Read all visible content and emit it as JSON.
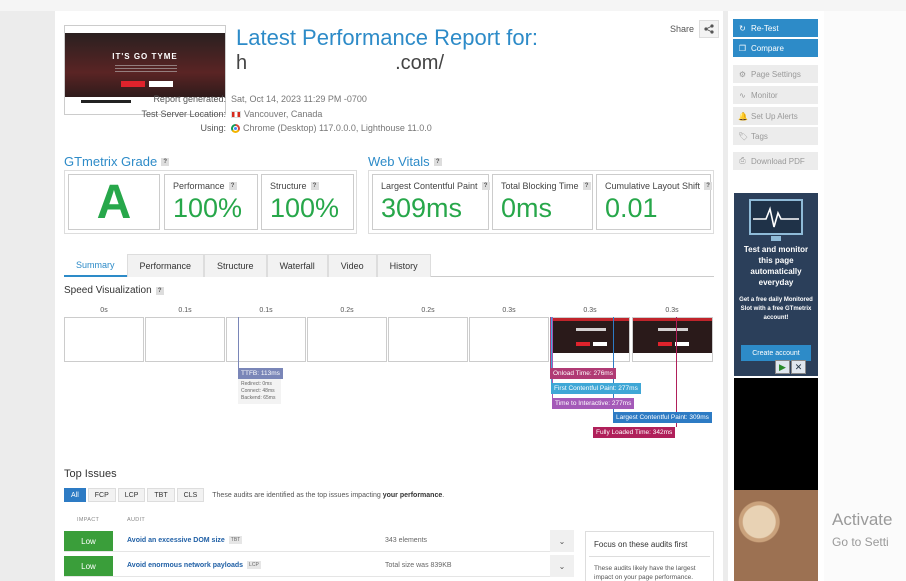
{
  "header": {
    "title": "Latest Performance Report for:",
    "url_visible_prefix": "h",
    "url_visible_suffix": ".com/",
    "share_label": "Share",
    "thumbnail_headline": "IT'S GO TYME"
  },
  "meta": {
    "report_generated_label": "Report generated:",
    "report_generated_value": "Sat, Oct 14, 2023 11:29 PM -0700",
    "location_label": "Test Server Location:",
    "location_value": "Vancouver, Canada",
    "using_label": "Using:",
    "using_value": "Chrome (Desktop) 117.0.0.0, Lighthouse 11.0.0"
  },
  "grade": {
    "section_title": "GTmetrix Grade",
    "letter": "A",
    "performance_label": "Performance",
    "performance_value": "100%",
    "structure_label": "Structure",
    "structure_value": "100%"
  },
  "vitals": {
    "section_title": "Web Vitals",
    "lcp_label": "Largest Contentful Paint",
    "lcp_value": "309ms",
    "tbt_label": "Total Blocking Time",
    "tbt_value": "0ms",
    "cls_label": "Cumulative Layout Shift",
    "cls_value": "0.01"
  },
  "tabs": [
    "Summary",
    "Performance",
    "Structure",
    "Waterfall",
    "Video",
    "History"
  ],
  "speed_viz": {
    "title": "Speed Visualization",
    "frame_labels": [
      "0s",
      "0.1s",
      "0.1s",
      "0.2s",
      "0.2s",
      "0.3s",
      "0.3s",
      "0.3s"
    ],
    "ttfb_tag": "TTFB: 113ms",
    "ttfb_redirect": "Redirect: 0ms",
    "ttfb_connect": "Connect: 48ms",
    "ttfb_backend": "Backend: 65ms",
    "onload_tag": "Onload Time: 276ms",
    "fcp_tag": "First Contentful Paint: 277ms",
    "tti_tag": "Time to Interactive: 277ms",
    "lcp_tag": "Largest Contentful Paint: 309ms",
    "fully_loaded_tag": "Fully Loaded Time: 342ms",
    "colors": {
      "ttfb": "#7a86b8",
      "onload": "#b03a74",
      "fcp": "#3fa7d6",
      "tti": "#a45ab8",
      "lcp": "#2d7bc4",
      "fully": "#b0205a"
    }
  },
  "top_issues": {
    "title": "Top Issues",
    "filters": [
      "All",
      "FCP",
      "LCP",
      "TBT",
      "CLS"
    ],
    "note_prefix": "These audits are identified as the top issues impacting",
    "note_bold": "your performance",
    "note_suffix": ".",
    "col_impact": "IMPACT",
    "col_audit": "AUDIT",
    "audits": [
      {
        "impact": "Low",
        "name": "Avoid an excessive DOM size",
        "metric": "TBT",
        "detail": "343 elements"
      },
      {
        "impact": "Low",
        "name": "Avoid enormous network payloads",
        "metric": "LCP",
        "detail": "Total size was 839KB"
      }
    ],
    "focus_title": "Focus on these audits first",
    "focus_desc": "These audits likely have the largest impact on your page performance."
  },
  "sidebar": {
    "retest": "Re-Test",
    "compare": "Compare",
    "page_settings": "Page Settings",
    "monitor": "Monitor",
    "alerts": "Set Up Alerts",
    "tags": "Tags",
    "download_pdf": "Download PDF",
    "ad_headline": "Test and monitor this page automatically everyday",
    "ad_body": "Get a free daily Monitored Slot with a free GTmetrix account!",
    "ad_cta": "Create account"
  },
  "overlay": {
    "activate_title": "Activate",
    "activate_sub": "Go to Setti"
  }
}
